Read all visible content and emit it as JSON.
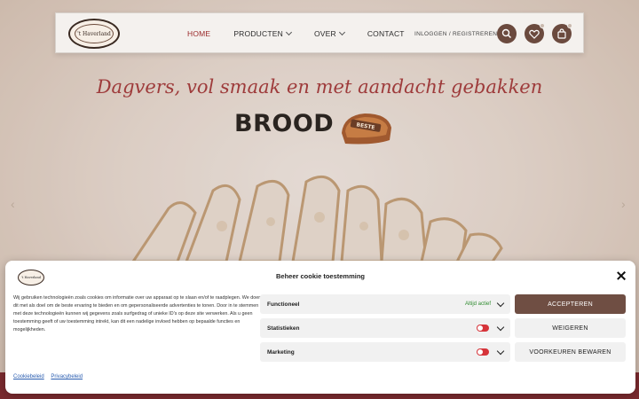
{
  "header": {
    "logo_text": "'t Haverland",
    "nav": [
      {
        "label": "HOME",
        "active": true,
        "dropdown": false
      },
      {
        "label": "PRODUCTEN",
        "active": false,
        "dropdown": true
      },
      {
        "label": "OVER",
        "active": false,
        "dropdown": true
      },
      {
        "label": "CONTACT",
        "active": false,
        "dropdown": false
      }
    ],
    "login_label": "INLOGGEN / REGISTREREN",
    "icons": [
      "search-icon",
      "heart-icon",
      "bag-icon"
    ]
  },
  "hero": {
    "tagline": "Dagvers, vol smaak en met aandacht gebakken",
    "title": "BROOD",
    "bread_label": "BESTE"
  },
  "cookie": {
    "logo_text": "'t Haverland",
    "title": "Beheer cookie toestemming",
    "text": "Wij gebruiken technologieën zoals cookies om informatie over uw apparaat op te slaan en/of te raadplegen. We doen dit met als doel om de beste ervaring te bieden en om gepersonaliseerde advertenties te tonen. Door in te stemmen met deze technologieën kunnen wij gegevens zoals surfgedrag of unieke ID's op deze site verwerken. Als u geen toestemming geeft of uw toestemming intrekt, kan dit een nadelige invloed hebben op bepaalde functies en mogelijkheden.",
    "categories": [
      {
        "label": "Functioneel",
        "status": "Altijd actief"
      },
      {
        "label": "Statistieken",
        "status": ""
      },
      {
        "label": "Marketing",
        "status": ""
      }
    ],
    "buttons": {
      "accept": "ACCEPTEREN",
      "deny": "WEIGEREN",
      "save": "VOORKEUREN BEWAREN"
    },
    "links": {
      "cookie_policy": "Cookiebeleid",
      "privacy_policy": "Privacybeleid"
    }
  },
  "colors": {
    "brand": "#6f4e43",
    "tagline": "#9e3b3b",
    "footer": "#7a2a2e",
    "toggle_off": "#d6343a",
    "active_green": "#2e8b2e"
  }
}
